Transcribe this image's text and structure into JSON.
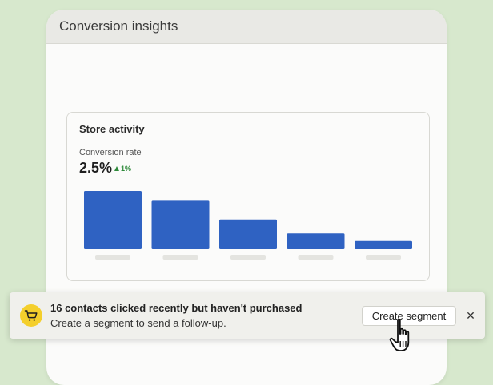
{
  "window": {
    "title": "Conversion insights"
  },
  "card": {
    "title": "Store activity",
    "metric_label": "Conversion rate",
    "metric_value": "2.5%",
    "metric_delta": "1%"
  },
  "chart_data": {
    "type": "bar",
    "categories": [
      "",
      "",
      "",
      "",
      ""
    ],
    "values": [
      100,
      83,
      51,
      27,
      14
    ],
    "title": "",
    "xlabel": "",
    "ylabel": "",
    "ylim": [
      0,
      100
    ],
    "grid": false,
    "bar_color": "#2f62c2",
    "placeholder_label_color": "#e4e4e0"
  },
  "toast": {
    "icon": "shopping-cart-icon",
    "title": "16 contacts clicked recently but haven't purchased",
    "subtitle": "Create a segment to send a follow-up.",
    "button_label": "Create segment",
    "close_label": "✕"
  },
  "colors": {
    "background": "#d7e8cd",
    "accent_blue": "#2f62c2",
    "positive_green": "#2e8a3a",
    "icon_yellow": "#f4cf2c"
  }
}
